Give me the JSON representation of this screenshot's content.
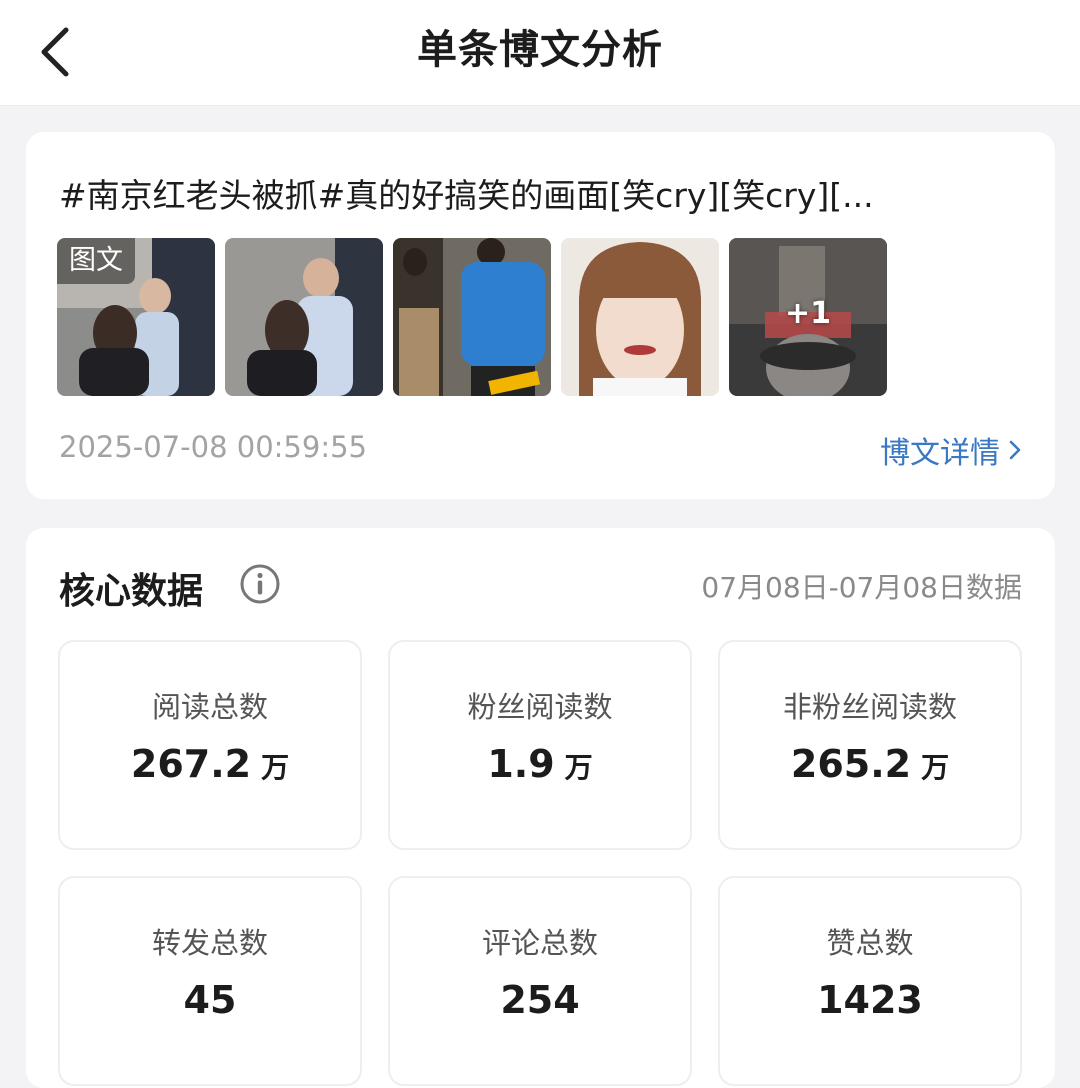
{
  "header": {
    "title": "单条博文分析",
    "back_icon": "chevron-left-icon"
  },
  "post": {
    "text": "#南京红老头被抓#真的好搞笑的画面[笑cry][笑cry][...",
    "thumbs": [
      {
        "tag": "图文"
      },
      {
        "tag": ""
      },
      {
        "tag": ""
      },
      {
        "tag": ""
      },
      {
        "tag": "",
        "more": "+1"
      }
    ],
    "time": "2025-07-08 00:59:55",
    "detail_link": "博文详情",
    "accent": "#3a78c3"
  },
  "core": {
    "title": "核心数据",
    "info_icon": "info-icon",
    "range": "07月08日-07月08日数据",
    "metrics": [
      {
        "label": "阅读总数",
        "value": "267.2",
        "unit": "万"
      },
      {
        "label": "粉丝阅读数",
        "value": "1.9",
        "unit": "万"
      },
      {
        "label": "非粉丝阅读数",
        "value": "265.2",
        "unit": "万"
      },
      {
        "label": "转发总数",
        "value": "45",
        "unit": ""
      },
      {
        "label": "评论总数",
        "value": "254",
        "unit": ""
      },
      {
        "label": "赞总数",
        "value": "1423",
        "unit": ""
      }
    ]
  }
}
